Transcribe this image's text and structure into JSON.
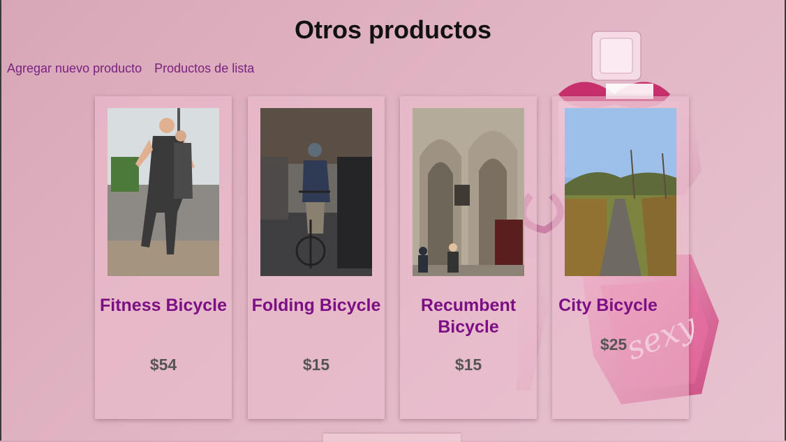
{
  "header": {
    "title": "Otros productos"
  },
  "nav": {
    "add_product": "Agregar nuevo producto",
    "list_products": "Productos de lista"
  },
  "products": [
    {
      "name": "Fitness Bicycle",
      "price": "$54",
      "image": "runners-photo"
    },
    {
      "name": "Folding Bicycle",
      "price": "$15",
      "image": "cyclist-rain-photo"
    },
    {
      "name": "Recumbent Bicycle",
      "price": "$15",
      "image": "cathedral-photo"
    },
    {
      "name": "City Bicycle",
      "price": "$25",
      "image": "country-path-photo"
    }
  ],
  "colors": {
    "title_text": "#7d0f84",
    "nav_link": "#7b1f7f",
    "price": "#555555"
  }
}
